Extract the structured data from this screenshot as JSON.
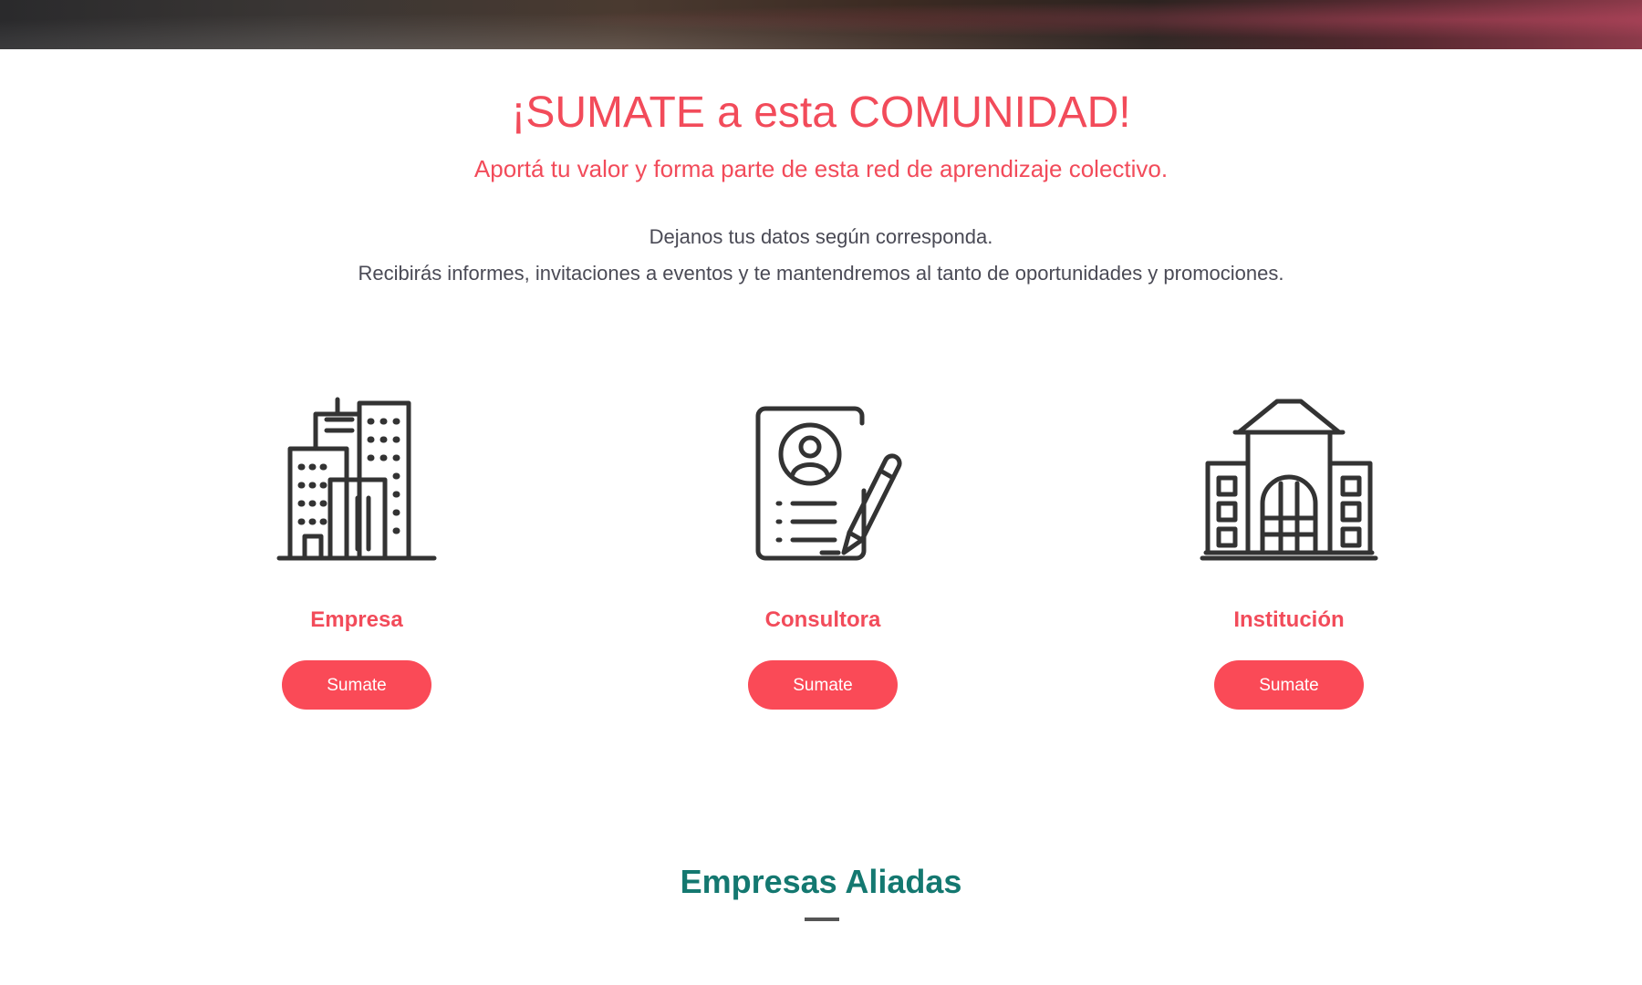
{
  "hero": {
    "title": "¡SUMATE a esta COMUNIDAD!",
    "subtitle": "Aportá  tu valor y forma parte de esta red de aprendizaje colectivo.",
    "description_line1": "Dejanos tus datos según corresponda.",
    "description_line2": "Recibirás  informes, invitaciones a eventos y te mantendremos al tanto de oportunidades y promociones."
  },
  "cards": [
    {
      "icon": "buildings-icon",
      "label": "Empresa",
      "button_label": "Sumate"
    },
    {
      "icon": "resume-form-pencil-icon",
      "label": "Consultora",
      "button_label": "Sumate"
    },
    {
      "icon": "institution-building-icon",
      "label": "Institución",
      "button_label": "Sumate"
    }
  ],
  "allies": {
    "title": "Empresas Aliadas"
  },
  "colors": {
    "accent": "#f24b5a",
    "button": "#fa4a57",
    "allies_title": "#147870",
    "body_text": "#4a4a55",
    "icon_stroke": "#333333"
  }
}
